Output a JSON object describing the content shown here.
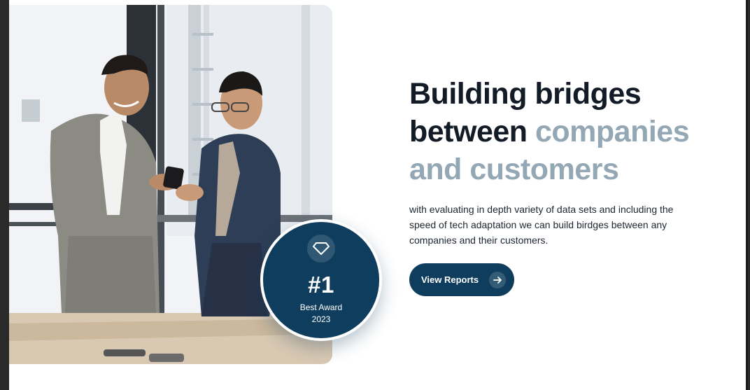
{
  "hero": {
    "title_line1": "Building bridges",
    "title_line2_dark": "between",
    "title_line2_muted": "companies",
    "title_line3_muted": "and customers",
    "description": "with evaluating in depth variety of data sets and including the speed of tech adaptation we can build birdges between any companies and their customers.",
    "cta_label": "View Reports",
    "cta_icon": "arrow-right-icon"
  },
  "badge": {
    "icon": "diamond-icon",
    "rank": "#1",
    "label": "Best Award",
    "year": "2023"
  },
  "photo": {
    "subject": "two businessmen looking at a phone"
  },
  "colors": {
    "primary": "#0f3d5e",
    "heading": "#131c26",
    "muted": "#93a7b5",
    "text": "#1d2630",
    "background": "#ffffff"
  }
}
